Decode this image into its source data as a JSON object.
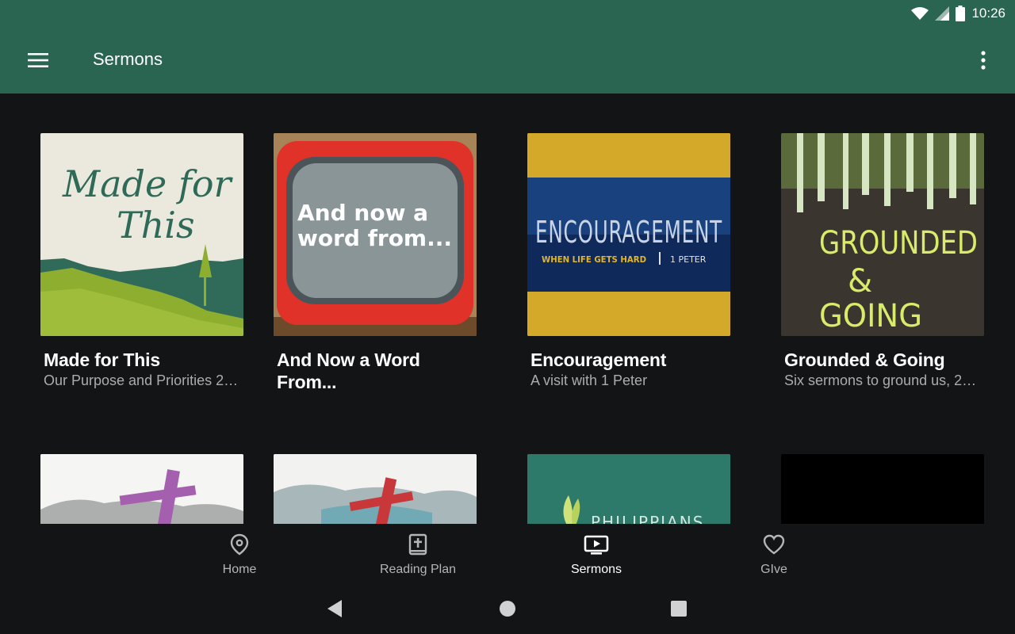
{
  "status": {
    "time": "10:26"
  },
  "appbar": {
    "title": "Sermons"
  },
  "cards": [
    {
      "title": "Made for This",
      "subtitle": "Our Purpose and Priorities 2…",
      "art_lines": [
        "Made for",
        "This"
      ]
    },
    {
      "title": "And Now a Word From...",
      "subtitle": "",
      "art_lines": [
        "And now a",
        "word from..."
      ]
    },
    {
      "title": "Encouragement",
      "subtitle": "A visit with 1 Peter",
      "art_lines": [
        "ENCOURAGEMENT",
        "WHEN LIFE GETS HARD",
        "1 PETER"
      ]
    },
    {
      "title": "Grounded & Going",
      "subtitle": "Six sermons to ground us, 2…",
      "art_lines": [
        "GROUNDED",
        "&",
        "GOING"
      ]
    }
  ],
  "row2_art": {
    "third_card_text": "PHILIPPIANS"
  },
  "bottom_nav": {
    "items": [
      {
        "label": "Home",
        "icon": "map-pin-icon"
      },
      {
        "label": "Reading Plan",
        "icon": "bible-icon"
      },
      {
        "label": "Sermons",
        "icon": "tv-play-icon"
      },
      {
        "label": "GIve",
        "icon": "heart-icon"
      }
    ],
    "active": "Sermons"
  },
  "colors": {
    "appbar": "#2a6552",
    "background": "#121416",
    "accent_gold": "#e2b52a"
  }
}
